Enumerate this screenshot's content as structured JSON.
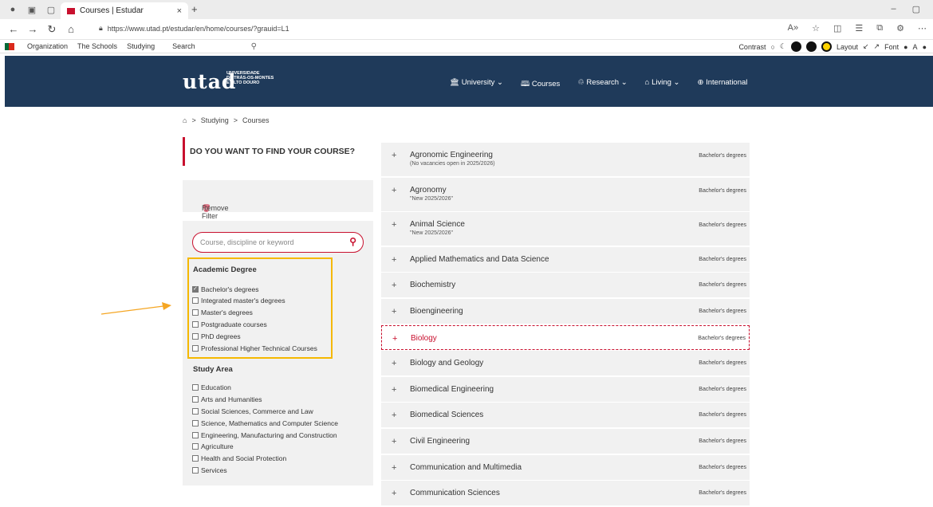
{
  "browser": {
    "tab_title": "Courses | Estudar",
    "tab_favicon_text": "utad",
    "url": "https://www.utad.pt/estudar/en/home/courses/?grauid=L1",
    "new_tab": "+",
    "close_tab": "×",
    "window_controls": [
      "–",
      "▢"
    ],
    "nav_icons": [
      "back-icon",
      "forward-icon",
      "refresh-icon",
      "home-icon"
    ]
  },
  "favorites": {
    "items": [
      "Organization",
      "The Schools",
      "Studying"
    ],
    "search_label": "Search"
  },
  "accessibility": {
    "contrast_label": "Contrast",
    "layout_label": "Layout",
    "font_label": "Font",
    "font_glyph": "A"
  },
  "site": {
    "logo": "utad",
    "logo_sub": [
      "UNIVERSIDADE",
      "DE TRÁS-OS-MONTES",
      "E ALTO DOURO"
    ],
    "nav": [
      {
        "label": "University",
        "icon": "building-icon",
        "dropdown": true
      },
      {
        "label": "Courses",
        "icon": "book-icon",
        "dropdown": false
      },
      {
        "label": "Research",
        "icon": "research-icon",
        "dropdown": true
      },
      {
        "label": "Living",
        "icon": "home-icon",
        "dropdown": true
      },
      {
        "label": "International",
        "icon": "globe-icon",
        "dropdown": false
      }
    ]
  },
  "breadcrumb": {
    "home_icon": "home-icon",
    "items": [
      "Studying",
      "Courses"
    ],
    "separator": ">"
  },
  "sidebar": {
    "find_title": "DO YOU WANT TO FIND YOUR COURSE?",
    "remove_filter": "Remove Filter",
    "search_placeholder": "Course, discipline or keyword",
    "academic_degree_title": "Academic Degree",
    "academic_degrees": [
      {
        "label": "Bachelor's degrees",
        "checked": true
      },
      {
        "label": "Integrated master's degrees",
        "checked": false
      },
      {
        "label": "Master's degrees",
        "checked": false
      },
      {
        "label": "Postgraduate courses",
        "checked": false
      },
      {
        "label": "PhD degrees",
        "checked": false
      },
      {
        "label": "Professional Higher Technical Courses",
        "checked": false
      }
    ],
    "study_area_title": "Study Area",
    "study_areas": [
      {
        "label": "Education",
        "checked": false
      },
      {
        "label": "Arts and Humanities",
        "checked": false
      },
      {
        "label": "Social Sciences, Commerce and Law",
        "checked": false
      },
      {
        "label": "Science, Mathematics and Computer Science",
        "checked": false
      },
      {
        "label": "Engineering, Manufacturing and Construction",
        "checked": false
      },
      {
        "label": "Agriculture",
        "checked": false
      },
      {
        "label": "Health and Social Protection",
        "checked": false
      },
      {
        "label": "Services",
        "checked": false
      }
    ]
  },
  "courses": [
    {
      "name": "Agronomic Engineering",
      "note": "(No vacancies open in 2025/2026)",
      "degree": "Bachelor's degrees",
      "active": false
    },
    {
      "name": "Agronomy",
      "note": "\"New 2025/2026\"",
      "degree": "Bachelor's degrees",
      "active": false
    },
    {
      "name": "Animal Science",
      "note": "\"New 2025/2026\"",
      "degree": "Bachelor's degrees",
      "active": false
    },
    {
      "name": "Applied Mathematics and Data Science",
      "note": "",
      "degree": "Bachelor's degrees",
      "active": false
    },
    {
      "name": "Biochemistry",
      "note": "",
      "degree": "Bachelor's degrees",
      "active": false
    },
    {
      "name": "Bioengineering",
      "note": "",
      "degree": "Bachelor's degrees",
      "active": false
    },
    {
      "name": "Biology",
      "note": "",
      "degree": "Bachelor's degrees",
      "active": true
    },
    {
      "name": "Biology and Geology",
      "note": "",
      "degree": "Bachelor's degrees",
      "active": false
    },
    {
      "name": "Biomedical Engineering",
      "note": "",
      "degree": "Bachelor's degrees",
      "active": false
    },
    {
      "name": "Biomedical Sciences",
      "note": "",
      "degree": "Bachelor's degrees",
      "active": false
    },
    {
      "name": "Civil Engineering",
      "note": "",
      "degree": "Bachelor's degrees",
      "active": false
    },
    {
      "name": "Communication and Multimedia",
      "note": "",
      "degree": "Bachelor's degrees",
      "active": false
    },
    {
      "name": "Communication Sciences",
      "note": "",
      "degree": "Bachelor's degrees",
      "active": false
    }
  ],
  "colors": {
    "brand_red": "#c8102e",
    "header_blue": "#1f3a5a",
    "highlight_yellow": "#f5b800",
    "arrow_orange": "#f5a623"
  }
}
